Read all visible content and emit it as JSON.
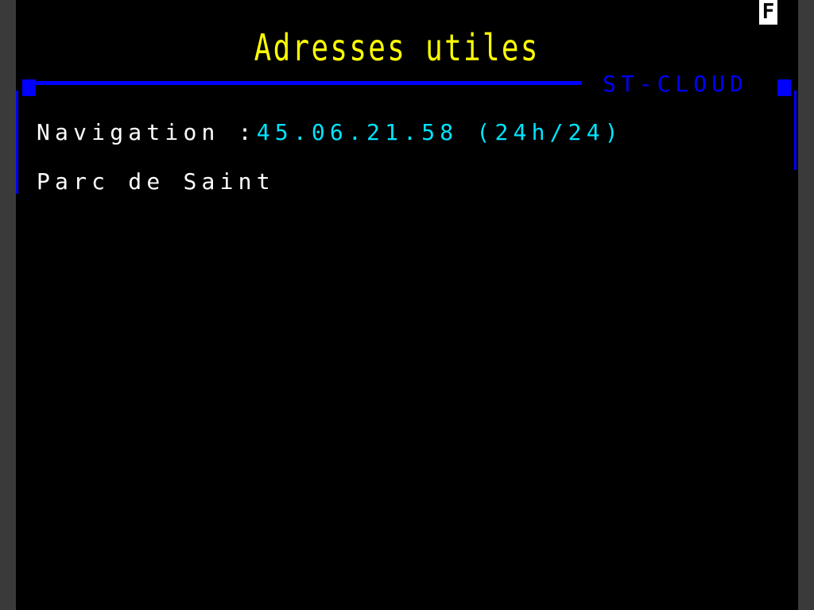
{
  "header": {
    "mode_indicator": "F",
    "title": "Adresses utiles"
  },
  "frame": {
    "label": "ST-CLOUD"
  },
  "content": {
    "navigation_label": "Navigation :",
    "navigation_phone": "45.06.21.58 (24h/24)",
    "park_label": "Parc de Saint"
  },
  "colors": {
    "background": "#000000",
    "title": "#ffff00",
    "frame": "#0000ff",
    "label_text": "#ffffff",
    "value_text": "#00e5ff"
  }
}
